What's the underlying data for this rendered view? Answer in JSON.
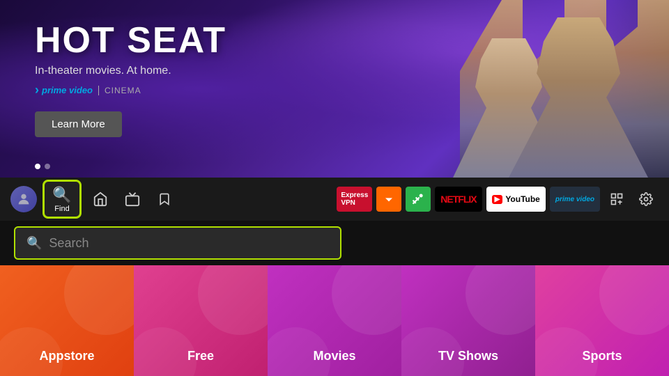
{
  "hero": {
    "title": "HOT SEAT",
    "subtitle": "In-theater movies. At home.",
    "prime_label": "prime video",
    "cinema_label": "CINEMA",
    "learn_more": "Learn More",
    "dots": [
      true,
      false
    ]
  },
  "navbar": {
    "find_label": "Find",
    "icons": {
      "home": "⌂",
      "tv": "📺",
      "bookmark": "🔖"
    }
  },
  "apps": [
    {
      "id": "expressvpn",
      "label": "ExpressVPN"
    },
    {
      "id": "downloader",
      "label": "⬇"
    },
    {
      "id": "feedly",
      "label": "f"
    },
    {
      "id": "netflix",
      "label": "NETFLIX"
    },
    {
      "id": "youtube",
      "label": "YouTube"
    },
    {
      "id": "prime",
      "label": "prime video"
    }
  ],
  "search": {
    "placeholder": "Search"
  },
  "categories": [
    {
      "id": "appstore",
      "label": "Appstore",
      "class": "cat-appstore"
    },
    {
      "id": "free",
      "label": "Free",
      "class": "cat-free"
    },
    {
      "id": "movies",
      "label": "Movies",
      "class": "cat-movies"
    },
    {
      "id": "tvshows",
      "label": "TV Shows",
      "class": "cat-tvshows"
    },
    {
      "id": "sports",
      "label": "Sports",
      "class": "cat-sports"
    }
  ]
}
